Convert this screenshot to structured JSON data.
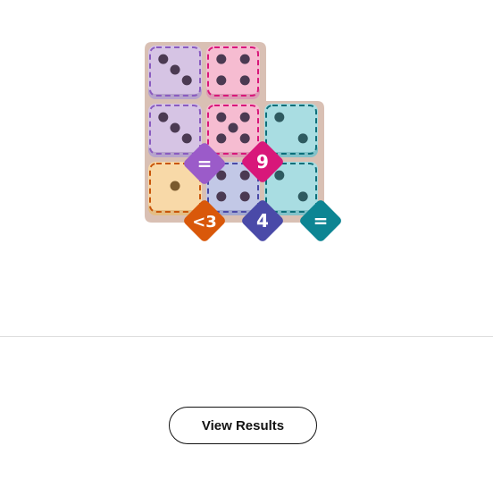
{
  "board": {
    "colors": {
      "frame": "#d9c0b4",
      "purple_tile": "#d6c4e4",
      "purple_shadow": "#b7a4cc",
      "pink_tile": "#f6bcd1",
      "pink_shadow": "#dc9bb4",
      "teal_tile": "#a9dde2",
      "teal_shadow": "#82c2c9",
      "orange_tile": "#f8d9a8",
      "orange_shadow": "#e3bd84",
      "blue_tile": "#c2c8e6",
      "blue_shadow": "#a1a8d0",
      "pip": "#4b3a52",
      "pip_teal": "#2e5a60",
      "pip_orange": "#7a5a2e"
    },
    "dice": [
      {
        "name": "die-r1c1",
        "value": 3,
        "region": "purple"
      },
      {
        "name": "die-r1c2",
        "value": 4,
        "region": "pink"
      },
      {
        "name": "die-r2c1",
        "value": 3,
        "region": "purple"
      },
      {
        "name": "die-r2c2",
        "value": 5,
        "region": "pink"
      },
      {
        "name": "die-r2c3",
        "value": 2,
        "region": "teal"
      },
      {
        "name": "die-r3c1",
        "value": 1,
        "region": "orange"
      },
      {
        "name": "die-r3c2",
        "value": 4,
        "region": "blue"
      },
      {
        "name": "die-r3c3",
        "value": 2,
        "region": "teal"
      }
    ],
    "constraints": [
      {
        "name": "constraint-badge-purple",
        "label": "=",
        "color": "#9b5bc9"
      },
      {
        "name": "constraint-badge-pink",
        "label": "9",
        "color": "#d8177a"
      },
      {
        "name": "constraint-badge-orange",
        "label": "<3",
        "color": "#d9580a"
      },
      {
        "name": "constraint-badge-blue",
        "label": "4",
        "color": "#4a4aa8"
      },
      {
        "name": "constraint-badge-teal",
        "label": "=",
        "color": "#0d8593"
      }
    ]
  },
  "results_button": {
    "label": "View Results"
  }
}
